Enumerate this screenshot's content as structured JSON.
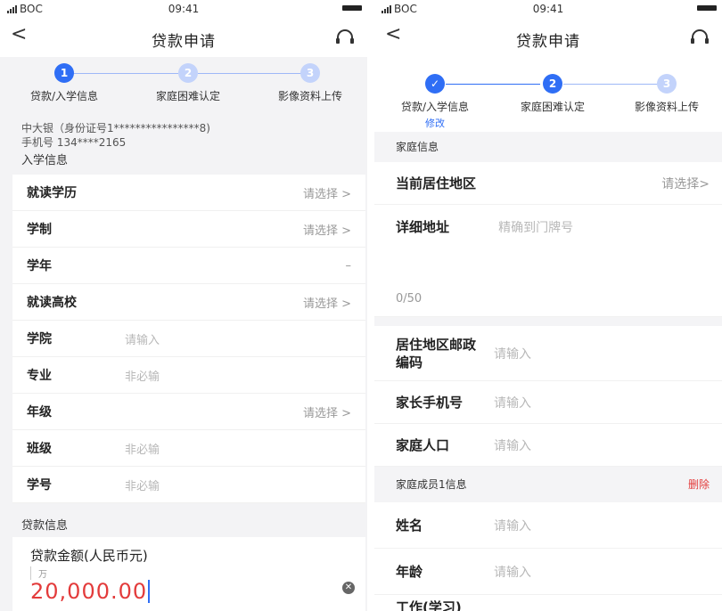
{
  "status": {
    "carrier": "BOC",
    "time": "09:41"
  },
  "left": {
    "nav": {
      "back": "<",
      "title": "贷款申请"
    },
    "steps": [
      {
        "num": "1",
        "label": "贷款/入学信息",
        "state": "active"
      },
      {
        "num": "2",
        "label": "家庭困难认定",
        "state": "pending"
      },
      {
        "num": "3",
        "label": "影像资料上传",
        "state": "pending"
      }
    ],
    "user": {
      "name_line": "中大银（身份证号1****************8)",
      "phone_line": "手机号 134****2165"
    },
    "enroll_section": "入学信息",
    "rows": [
      {
        "label": "就读学历",
        "value": "",
        "right": "请选择 >"
      },
      {
        "label": "学制",
        "value": "",
        "right": "请选择 >"
      },
      {
        "label": "学年",
        "value": "",
        "right": "–"
      },
      {
        "label": "就读高校",
        "value": "",
        "right": "请选择 >"
      },
      {
        "label": "学院",
        "value": "请输入",
        "right": ""
      },
      {
        "label": "专业",
        "value": "非必输",
        "right": ""
      },
      {
        "label": "年级",
        "value": "",
        "right": "请选择 >"
      },
      {
        "label": "班级",
        "value": "非必输",
        "right": ""
      },
      {
        "label": "学号",
        "value": "非必输",
        "right": ""
      }
    ],
    "loan_section": "贷款信息",
    "loan": {
      "label": "贷款金额(人民币元)",
      "unit": "万",
      "amount": "20,000.00"
    }
  },
  "right": {
    "nav": {
      "back": "<",
      "title": "贷款申请"
    },
    "steps": [
      {
        "num": "✓",
        "label": "贷款/入学信息",
        "sub": "修改",
        "state": "active"
      },
      {
        "num": "2",
        "label": "家庭困难认定",
        "sub": "",
        "state": "active"
      },
      {
        "num": "3",
        "label": "影像资料上传",
        "sub": "",
        "state": "pending"
      }
    ],
    "family_section": "家庭信息",
    "region": {
      "label": "当前居住地区",
      "right": "请选择>"
    },
    "address": {
      "label": "详细地址",
      "placeholder": "精确到门牌号",
      "count": "0/50"
    },
    "postcode": {
      "label_line1": "居住地区邮政",
      "label_line2": "编码",
      "placeholder": "请输入"
    },
    "parent_phone": {
      "label": "家长手机号",
      "placeholder": "请输入"
    },
    "population": {
      "label": "家庭人口",
      "placeholder": "请输入"
    },
    "member_section": "家庭成员1信息",
    "delete_label": "删除",
    "member_rows": [
      {
        "label": "姓名",
        "placeholder": "请输入"
      },
      {
        "label": "年龄",
        "placeholder": "请输入"
      }
    ],
    "partial_label": "工作(学习)"
  },
  "colors": {
    "accent": "#2f6ef5",
    "amount": "#e33b3b",
    "delete": "#e33b3b"
  },
  "icons": [
    "signal-icon",
    "battery-icon",
    "back-icon",
    "headset-icon",
    "check-icon",
    "clear-icon"
  ]
}
